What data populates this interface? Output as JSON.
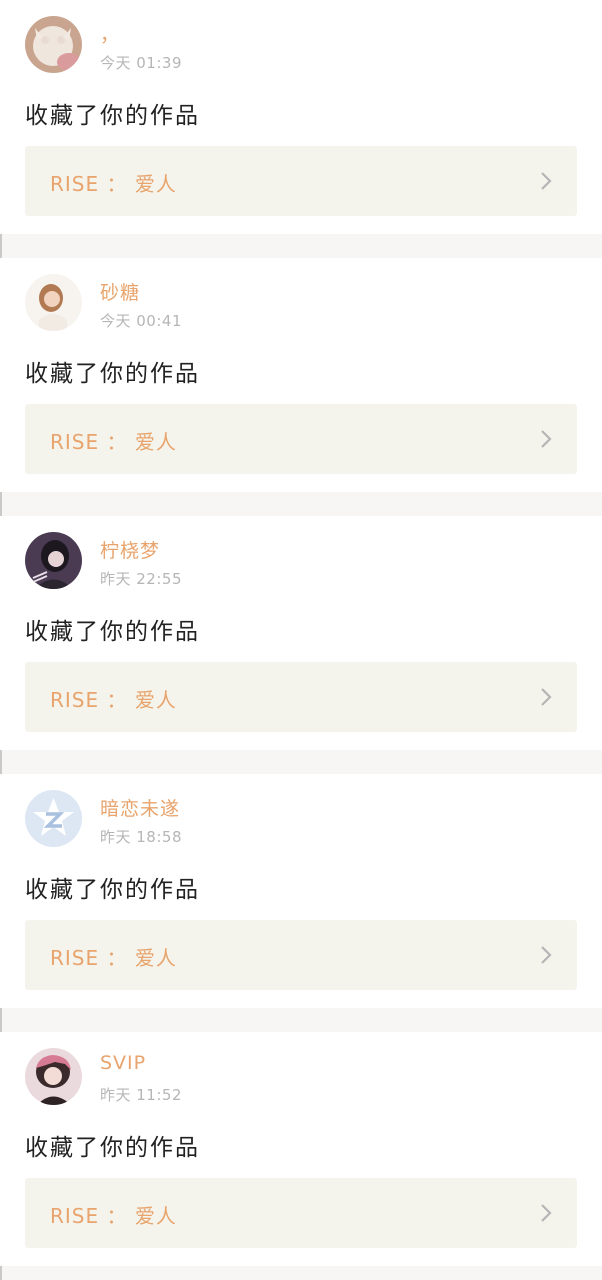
{
  "notifications": [
    {
      "username": "，",
      "time": "今天 01:39",
      "action": "收藏了你的作品",
      "work_title": "RISE ： 爱人",
      "avatar": "cat-avatar"
    },
    {
      "username": "砂糖",
      "time": "今天 00:41",
      "action": "收藏了你的作品",
      "work_title": "RISE ： 爱人",
      "avatar": "girl-avatar"
    },
    {
      "username": "柠桡梦",
      "time": "昨天 22:55",
      "action": "收藏了你的作品",
      "work_title": "RISE ： 爱人",
      "avatar": "dark-girl-avatar"
    },
    {
      "username": "暗恋未遂",
      "time": "昨天 18:58",
      "action": "收藏了你的作品",
      "work_title": "RISE ： 爱人",
      "avatar": "z-logo-avatar"
    },
    {
      "username": "SVIP",
      "time": "昨天 11:52",
      "action": "收藏了你的作品",
      "work_title": "RISE ： 爱人",
      "avatar": "pink-hair-girl-avatar"
    }
  ],
  "colors": {
    "accent": "#e8a46c",
    "time_gray": "#b6b6b6",
    "work_bg": "#f4f3ec",
    "separator": "#f7f6f5"
  }
}
